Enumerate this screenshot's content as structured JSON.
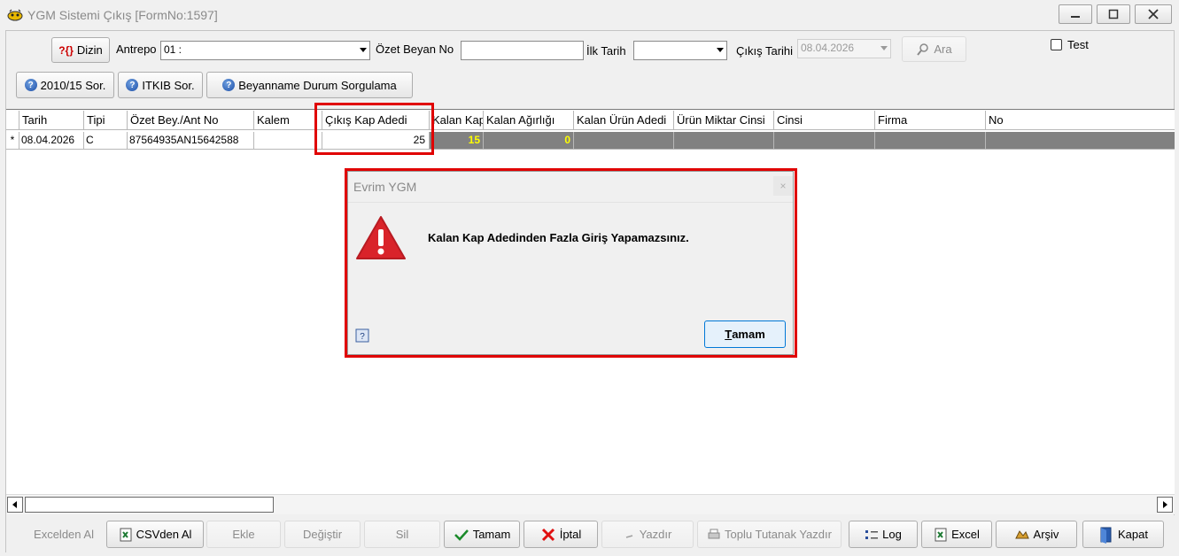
{
  "window": {
    "title": "YGM Sistemi Çıkış [FormNo:1597]"
  },
  "toolbar": {
    "dizin_label": "Dizin",
    "antrepo_label": "Antrepo",
    "antrepo_value": "01 :",
    "ozet_beyan_label": "Özet Beyan No",
    "ozet_beyan_value": "",
    "ilk_tarih_label": "İlk Tarih",
    "ilk_tarih_value": "",
    "cikis_tarihi_label": "Çıkış Tarihi",
    "cikis_tarihi_value": "08.04.2026",
    "ara_label": "Ara",
    "test_label": "Test",
    "btn_2010": "2010/15 Sor.",
    "btn_itkib": "ITKIB Sor.",
    "btn_beyanname": "Beyanname Durum Sorgulama"
  },
  "grid": {
    "columns": [
      "Tarih",
      "Tipi",
      "Özet Bey./Ant No",
      "Kalem",
      "Çıkış Kap Adedi",
      "Kalan Kap",
      "Kalan Ağırlığı",
      "Kalan Ürün Adedi",
      "Ürün Miktar Cinsi",
      "Cinsi",
      "Firma",
      "No"
    ],
    "row_indicator": "*",
    "row": {
      "tarih": "08.04.2026",
      "tipi": "C",
      "ozet": "87564935AN15642588",
      "kalem": "",
      "cikis_kap": "25",
      "kalan_kap": "15",
      "kalan_agirlik": "0"
    }
  },
  "dialog": {
    "title": "Evrim YGM",
    "message": "Kalan Kap Adedinden Fazla Giriş Yapamazsınız.",
    "ok_label": "Tamam",
    "ok_underline": "T",
    "ok_rest": "amam"
  },
  "bottom": {
    "excelden_al": "Excelden Al",
    "csvden_al": "CSVden Al",
    "ekle": "Ekle",
    "degistir": "Değiştir",
    "sil": "Sil",
    "tamam": "Tamam",
    "iptal": "İptal",
    "yazdir": "Yazdır",
    "toplu": "Toplu Tutanak Yazdır",
    "log": "Log",
    "excel": "Excel",
    "arsiv": "Arşiv",
    "kapat": "Kapat"
  },
  "colors": {
    "highlight_red": "#e00000",
    "row_dark": "#818181",
    "value_yellow": "#ffff00",
    "warning_red": "#d9232a"
  }
}
